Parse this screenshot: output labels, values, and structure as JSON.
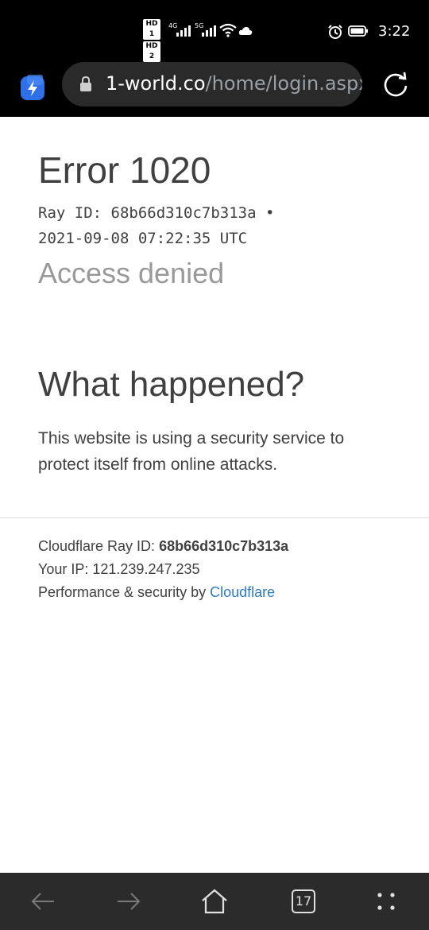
{
  "status_bar": {
    "sim1_label": "HD 1",
    "sim2_label": "HD 2",
    "net1": "4G",
    "net2": "5G",
    "time": "3:22",
    "icons": [
      "signal-icon",
      "wifi-icon",
      "cloud-icon",
      "alarm-icon",
      "battery-icon"
    ]
  },
  "browser": {
    "url_host": "1-world.co",
    "url_path": "/home/login.aspx?",
    "icons": [
      "app-bolt-icon",
      "lock-icon",
      "reload-icon"
    ]
  },
  "page": {
    "title": "Error 1020",
    "ray_line": "Ray ID: 68b66d310c7b313a •",
    "timestamp": "2021-09-08 07:22:35 UTC",
    "subtitle": "Access denied",
    "what_heading": "What happened?",
    "description": "This website is using a security service to protect itself from online attacks.",
    "footer": {
      "ray_label": "Cloudflare Ray ID: ",
      "ray_value": "68b66d310c7b313a",
      "ip_line": "Your IP: 121.239.247.235",
      "perf_label": "Performance & security by ",
      "cloudflare_link": "Cloudflare"
    }
  },
  "nav_bar": {
    "tab_count": "17",
    "icons": [
      "back-arrow-icon",
      "forward-arrow-icon",
      "home-icon",
      "tabs-icon",
      "more-icon"
    ]
  },
  "colors": {
    "text": "#404040",
    "muted": "#999999",
    "link": "#2f7bbf",
    "chrome_bg": "#000000",
    "nav_bg": "#2b2b2b"
  }
}
